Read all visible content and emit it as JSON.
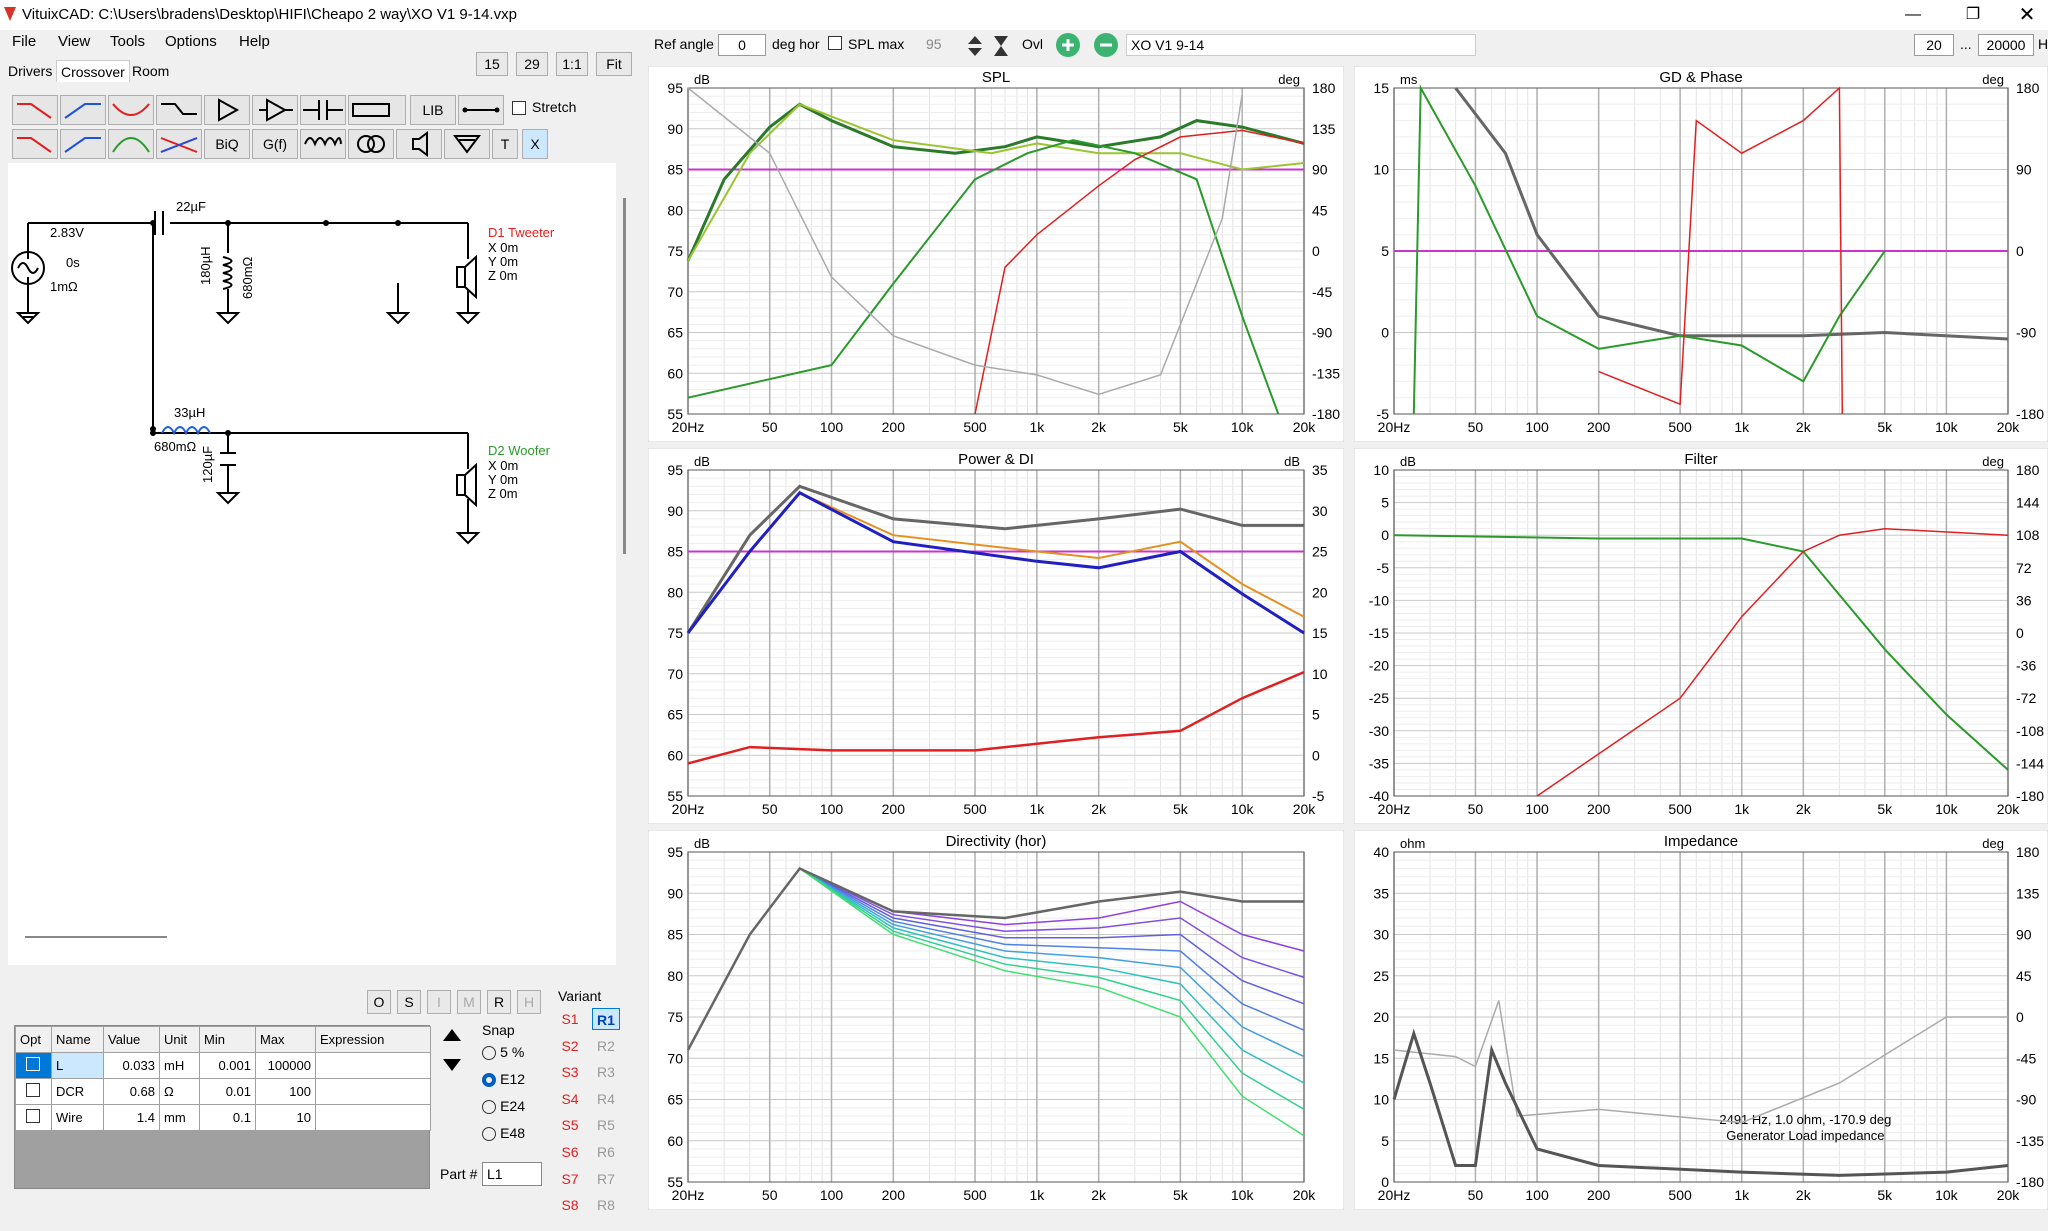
{
  "title": "VituixCAD: C:\\Users\\bradens\\Desktop\\HIFI\\Cheapo 2 way\\XO V1 9-14.vxp",
  "menu": [
    "File",
    "View",
    "Tools",
    "Options",
    "Help"
  ],
  "tabs": [
    "Drivers",
    "Crossover",
    "Room"
  ],
  "zoom": {
    "a": "15",
    "b": "29",
    "c": "1:1",
    "d": "Fit"
  },
  "top": {
    "ref_angle_label": "Ref angle",
    "ref_angle": "0",
    "deg_hor": "deg hor",
    "spl_max_label": "SPL max",
    "spl_max": "95",
    "ovl": "Ovl",
    "name": "XO V1 9-14",
    "fmin": "20",
    "dots": "...",
    "fmax": "20000",
    "hz": "Hz"
  },
  "toolbar": {
    "lib": "LIB",
    "stretch": "Stretch",
    "biq": "BiQ",
    "gf": "G(f)",
    "t": "T",
    "x": "X"
  },
  "schematic": {
    "src_v": "2.83V",
    "src_t": "0s",
    "src_r": "1mΩ",
    "c1": "22µF",
    "l1": "180µH",
    "l1r": "680mΩ",
    "d1": "D1 Tweeter",
    "xyz": [
      "X 0m",
      "Y 0m",
      "Z 0m"
    ],
    "l2": "33µH",
    "l2r": "680mΩ",
    "c2": "120µF",
    "d2": "D2 Woofer"
  },
  "params": {
    "cols": [
      "Opt",
      "Name",
      "Value",
      "Unit",
      "Min",
      "Max",
      "Expression"
    ],
    "rows": [
      {
        "name": "L",
        "value": "0.033",
        "unit": "mH",
        "min": "0.001",
        "max": "100000"
      },
      {
        "name": "DCR",
        "value": "0.68",
        "unit": "Ω",
        "min": "0.01",
        "max": "100"
      },
      {
        "name": "Wire",
        "value": "1.4",
        "unit": "mm",
        "min": "0.1",
        "max": "10"
      }
    ]
  },
  "btns": [
    "O",
    "S",
    "I",
    "M",
    "R",
    "H"
  ],
  "snap": {
    "label": "Snap",
    "opts": [
      "5 %",
      "E12",
      "E24",
      "E48"
    ]
  },
  "part_label": "Part #",
  "part": "L1",
  "variant": {
    "label": "Variant",
    "s": [
      "S1",
      "S2",
      "S3",
      "S4",
      "S5",
      "S6",
      "S7",
      "S8"
    ],
    "r": [
      "R1",
      "R2",
      "R3",
      "R4",
      "R5",
      "R6",
      "R7",
      "R8"
    ]
  },
  "xticks": [
    "20Hz",
    "50",
    "100",
    "200",
    "500",
    "1k",
    "2k",
    "5k",
    "10k",
    "20k"
  ],
  "charts": [
    {
      "title": "SPL",
      "yunit": "dB",
      "y2unit": "deg",
      "yticks": [
        "95",
        "90",
        "85",
        "80",
        "75",
        "70",
        "65",
        "60",
        "55"
      ],
      "y2ticks": [
        "180",
        "135",
        "90",
        "45",
        "0",
        "-45",
        "-90",
        "-135",
        "-180"
      ]
    },
    {
      "title": "GD & Phase",
      "yunit": "ms",
      "y2unit": "deg",
      "yticks": [
        "15",
        "10",
        "5",
        "0",
        "-5"
      ],
      "y2ticks": [
        "180",
        "90",
        "0",
        "-90",
        "-180"
      ]
    },
    {
      "title": "Power & DI",
      "yunit": "dB",
      "y2unit": "dB",
      "yticks": [
        "95",
        "90",
        "85",
        "80",
        "75",
        "70",
        "65",
        "60",
        "55"
      ],
      "y2ticks": [
        "35",
        "30",
        "25",
        "20",
        "15",
        "10",
        "5",
        "0",
        "-5"
      ]
    },
    {
      "title": "Filter",
      "yunit": "dB",
      "y2unit": "deg",
      "yticks": [
        "10",
        "5",
        "0",
        "-5",
        "-10",
        "-15",
        "-20",
        "-25",
        "-30",
        "-35",
        "-40"
      ],
      "y2ticks": [
        "180",
        "144",
        "108",
        "72",
        "36",
        "0",
        "-36",
        "-72",
        "-108",
        "-144",
        "-180"
      ]
    },
    {
      "title": "Directivity (hor)",
      "yunit": "dB",
      "yticks": [
        "95",
        "90",
        "85",
        "80",
        "75",
        "70",
        "65",
        "60",
        "55"
      ]
    },
    {
      "title": "Impedance",
      "yunit": "ohm",
      "y2unit": "deg",
      "yticks": [
        "40",
        "35",
        "30",
        "25",
        "20",
        "15",
        "10",
        "5",
        "0"
      ],
      "y2ticks": [
        "180",
        "135",
        "90",
        "45",
        "0",
        "-45",
        "-90",
        "-135",
        "-180"
      ],
      "note1": "2491 Hz, 1.0 ohm, -170.9 deg",
      "note2": "Generator Load impedance"
    }
  ],
  "colors": {
    "tweeter": "#e02020",
    "woofer": "#2a9a2a",
    "total": "#707070",
    "ref": "#cc33cc",
    "power": "#2020c0"
  }
}
